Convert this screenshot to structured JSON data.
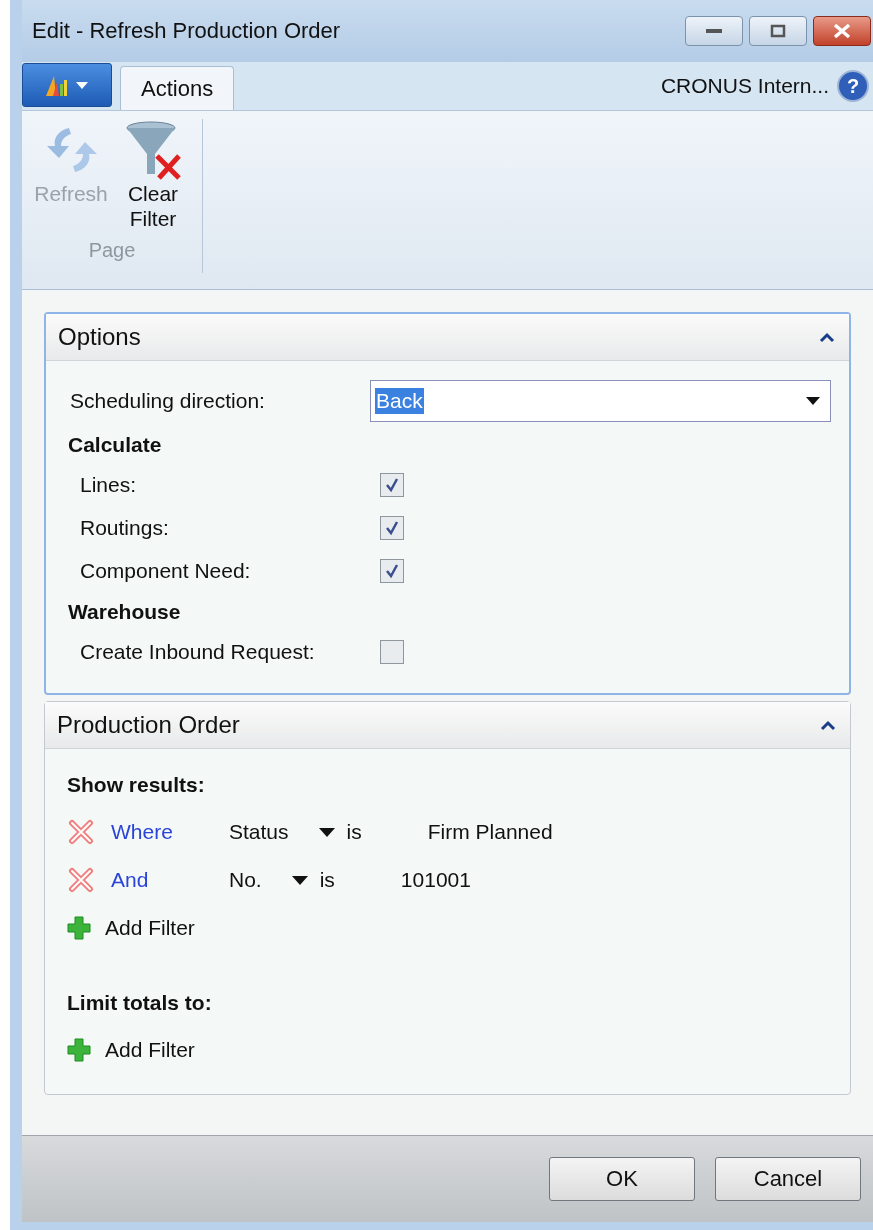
{
  "window": {
    "title": "Edit - Refresh Production Order"
  },
  "ribbon": {
    "tabs": [
      {
        "label": "Actions",
        "selected": true
      }
    ],
    "company": "CRONUS Intern...",
    "help": "?",
    "groups": [
      {
        "label": "Page",
        "actions": [
          {
            "kind": "refresh",
            "label": "Refresh",
            "disabled": true
          },
          {
            "kind": "clear-filter",
            "label": "Clear Filter",
            "disabled": false
          }
        ]
      }
    ]
  },
  "options": {
    "title": "Options",
    "expanded": true,
    "scheduling_direction": {
      "label": "Scheduling direction:",
      "value": "Back"
    },
    "groups": [
      {
        "heading": "Calculate",
        "fields": [
          {
            "label": "Lines:",
            "checked": true
          },
          {
            "label": "Routings:",
            "checked": true
          },
          {
            "label": "Component Need:",
            "checked": true
          }
        ]
      },
      {
        "heading": "Warehouse",
        "fields": [
          {
            "label": "Create Inbound Request:",
            "checked": false
          }
        ]
      }
    ]
  },
  "production_order": {
    "title": "Production Order",
    "expanded": true,
    "sections": [
      {
        "heading": "Show results:",
        "filters": [
          {
            "connector": "Where",
            "field": "Status",
            "operator": "is",
            "value": "Firm Planned"
          },
          {
            "connector": "And",
            "field": "No.",
            "operator": "is",
            "value": "101001"
          }
        ],
        "add_filter": "Add Filter"
      },
      {
        "heading": "Limit totals to:",
        "add_filter": "Add Filter"
      }
    ]
  },
  "buttons": [
    {
      "label": "OK"
    },
    {
      "label": "Cancel"
    }
  ]
}
